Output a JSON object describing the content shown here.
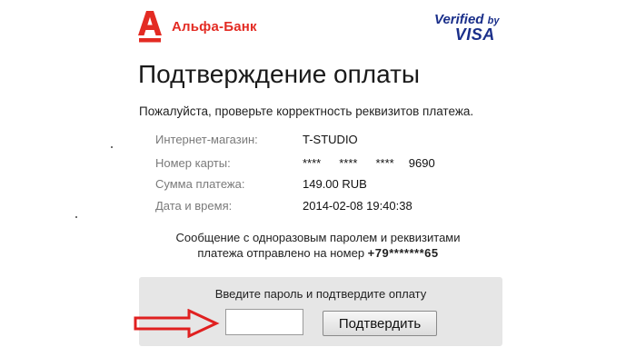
{
  "header": {
    "bank_name": "Альфа-Банк",
    "verified_line1": "Verified",
    "verified_by": "by",
    "verified_line2": "VISA",
    "logo_icon": "alfa-bank-logo-icon",
    "brand_color": "#e32b23",
    "visa_color": "#1a2f8a"
  },
  "main": {
    "title": "Подтверждение оплаты",
    "intro": "Пожалуйста, проверьте корректность реквизитов платежа.",
    "details": {
      "merchant_label": "Интернет-магазин:",
      "merchant_value": "T-STUDIO",
      "card_label": "Номер карты:",
      "card_mask1": "****",
      "card_mask2": "****",
      "card_mask3": "****",
      "card_last": "9690",
      "amount_label": "Сумма платежа:",
      "amount_value": "149.00 RUB",
      "datetime_label": "Дата и время:",
      "datetime_value": "2014-02-08 19:40:38"
    },
    "message_line1": "Сообщение с одноразовым паролем и реквизитами",
    "message_line2_prefix": "платежа отправлено на номер ",
    "message_phone": "+79*******65"
  },
  "confirm": {
    "label": "Введите пароль и подтвердите оплату",
    "password_value": "",
    "button_label": "Подтвердить",
    "arrow_icon": "arrow-right-icon",
    "arrow_color": "#e02020"
  }
}
